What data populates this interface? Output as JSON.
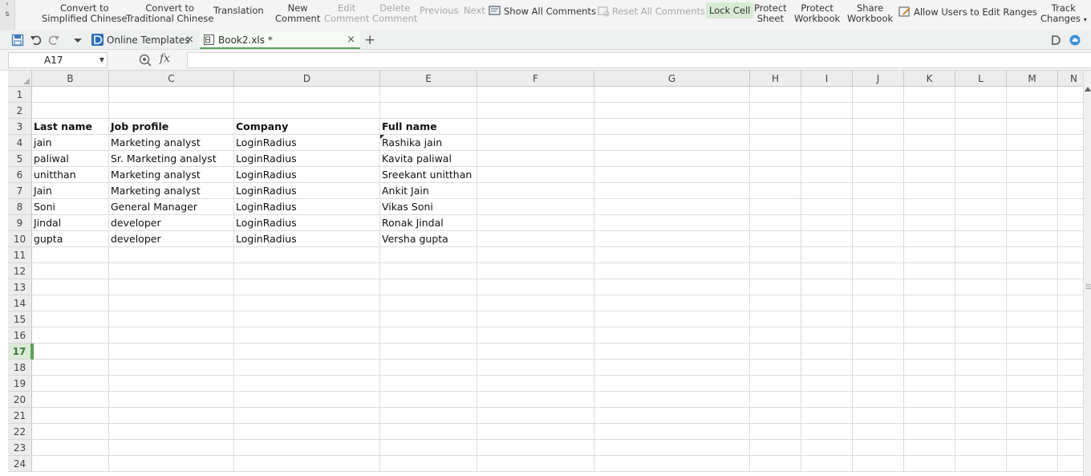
{
  "ribbon": {
    "scroll_label": "s",
    "convert_simplified": [
      "Convert to",
      "Simplified Chinese"
    ],
    "convert_traditional": [
      "Convert to",
      "Traditional Chinese"
    ],
    "translation": "Translation",
    "new_comment": [
      "New",
      "Comment"
    ],
    "edit_comment": [
      "Edit",
      "Comment"
    ],
    "delete_comment": [
      "Delete",
      "Comment"
    ],
    "previous": "Previous",
    "next": "Next",
    "show_all_comments": "Show All Comments",
    "reset_all_comments": "Reset All Comments",
    "lock_cell": "Lock Cell",
    "protect_sheet": [
      "Protect",
      "Sheet"
    ],
    "protect_workbook": [
      "Protect",
      "Workbook"
    ],
    "share_workbook": [
      "Share",
      "Workbook"
    ],
    "allow_edit_ranges": "Allow Users to Edit Ranges",
    "track_changes": [
      "Track",
      "Changes"
    ]
  },
  "tabs": {
    "online_templates": "Online Templates",
    "book": "Book2.xls *",
    "close_glyph": "×",
    "add_glyph": "+"
  },
  "formula_bar": {
    "name_box": "A17",
    "fx": "fx",
    "formula": ""
  },
  "grid": {
    "selected_row": 17,
    "columns": [
      "B",
      "C",
      "D",
      "E",
      "F",
      "G",
      "H",
      "I",
      "J",
      "K",
      "L",
      "M",
      "N"
    ],
    "row_numbers": [
      1,
      2,
      3,
      4,
      5,
      6,
      7,
      8,
      9,
      10,
      11,
      12,
      13,
      14,
      15,
      16,
      17,
      18,
      19,
      20,
      21,
      22,
      23,
      24
    ],
    "header_row": [
      "Last name",
      "Job profile",
      "Company",
      "Full name"
    ],
    "rows": [
      [
        "jain",
        "Marketing analyst",
        "LoginRadius",
        "Rashika jain"
      ],
      [
        "paliwal",
        "Sr. Marketing analyst",
        "LoginRadius",
        "Kavita  paliwal"
      ],
      [
        "unitthan",
        "Marketing analyst",
        "LoginRadius",
        "Sreekant unitthan"
      ],
      [
        "Jain",
        "Marketing analyst",
        "LoginRadius",
        "Ankit  Jain"
      ],
      [
        "Soni",
        "General Manager",
        "LoginRadius",
        "Vikas  Soni"
      ],
      [
        "Jindal",
        "developer",
        "LoginRadius",
        "Ronak  Jindal"
      ],
      [
        "gupta",
        "developer",
        "LoginRadius",
        "Versha  gupta"
      ]
    ]
  },
  "colors": {
    "accent_green": "#5aa05a",
    "lock_cell_bg": "#d7ebd3"
  }
}
